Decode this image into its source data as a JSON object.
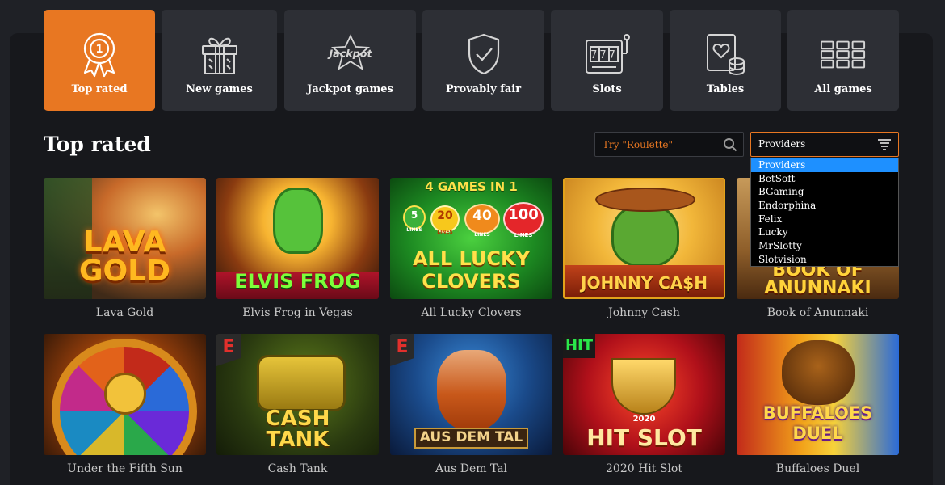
{
  "categories": [
    {
      "label": "Top rated",
      "icon": "medal-icon",
      "active": true
    },
    {
      "label": "New games",
      "icon": "gift-icon",
      "active": false
    },
    {
      "label": "Jackpot games",
      "icon": "jackpot-star-icon",
      "active": false
    },
    {
      "label": "Provably fair",
      "icon": "shield-check-icon",
      "active": false
    },
    {
      "label": "Slots",
      "icon": "slot-machine-icon",
      "active": false
    },
    {
      "label": "Tables",
      "icon": "card-chips-icon",
      "active": false
    },
    {
      "label": "All games",
      "icon": "grid-icon",
      "active": false
    }
  ],
  "icon_labels": {
    "medal_number": "1",
    "jackpot_word": "Jackpot",
    "slot_reels": "777"
  },
  "section_title": "Top rated",
  "search": {
    "placeholder": "Try \"Roulette\"",
    "icon": "search-icon"
  },
  "providers": {
    "selected": "Providers",
    "icon": "filter-icon",
    "options": [
      "Providers",
      "BetSoft",
      "BGaming",
      "Endorphina",
      "Felix",
      "Lucky",
      "MrSlotty",
      "Slotvision"
    ]
  },
  "games": [
    {
      "name": "Lava Gold",
      "art": "LAVA GOLD"
    },
    {
      "name": "Elvis Frog in Vegas",
      "art": "ELVIS FROG"
    },
    {
      "name": "All Lucky Clovers",
      "art": "ALL LUCKY CLOVERS",
      "art_top": "4 GAMES IN 1",
      "lines": [
        "5",
        "20",
        "40",
        "100"
      ],
      "lines_word": "LINES"
    },
    {
      "name": "Johnny Cash",
      "art": "JOHNNY CA$H"
    },
    {
      "name": "Book of Anunnaki",
      "art": "BOOK OF ANUNNAKI"
    },
    {
      "name": "Under the Fifth Sun",
      "art": ""
    },
    {
      "name": "Cash Tank",
      "art": "CASH TANK",
      "badge": "E"
    },
    {
      "name": "Aus Dem Tal",
      "art": "AUS DEM TAL",
      "badge": "E"
    },
    {
      "name": "2020 Hit Slot",
      "art": "HIT SLOT",
      "art_top": "HIT",
      "art_year": "2020"
    },
    {
      "name": "Buffaloes Duel",
      "art": "BUFFALOES DUEL"
    }
  ],
  "colors": {
    "accent": "#e87722",
    "tile": "#2d2f35",
    "background": "#1f2126",
    "panel": "#17181c",
    "highlight": "#1e90ff"
  }
}
